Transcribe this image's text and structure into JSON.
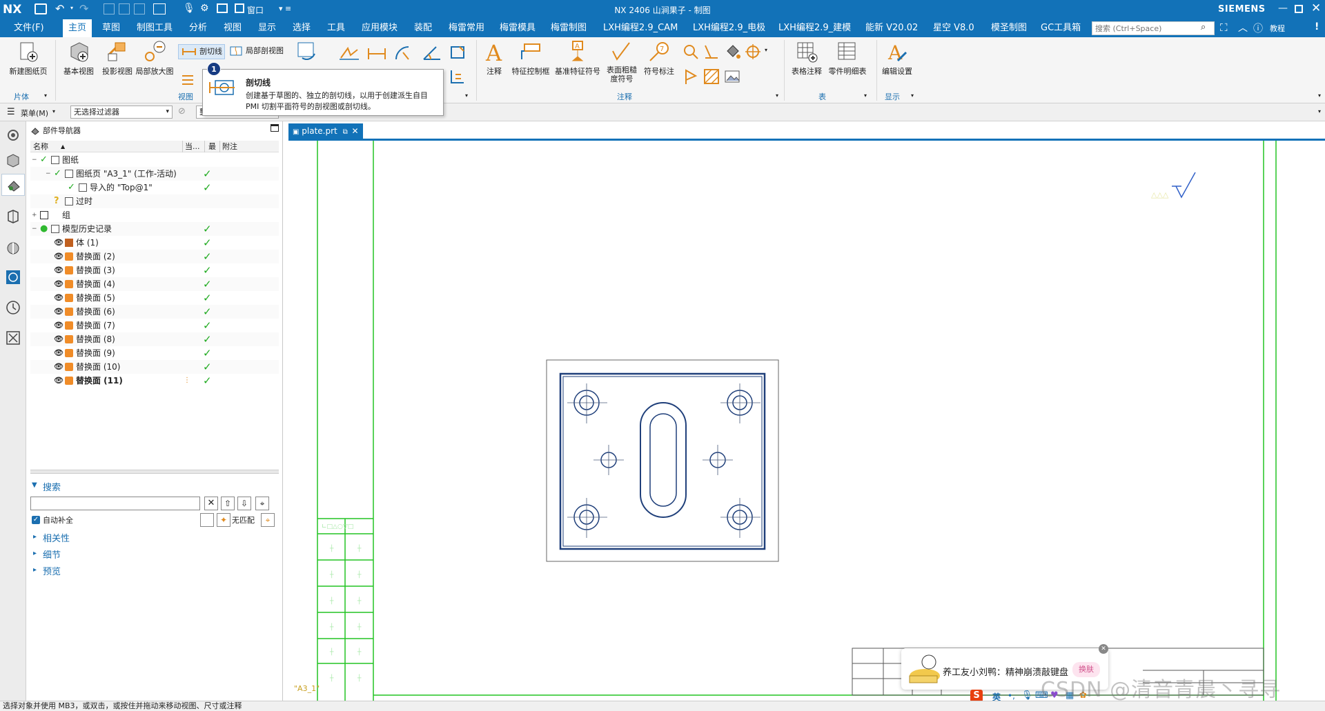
{
  "titlebar": {
    "logo": "NX",
    "title": "NX 2406 山涧果子 - 制图",
    "window_menu": "窗口",
    "brand": "SIEMENS"
  },
  "menubar": {
    "items": [
      "文件(F)",
      "主页",
      "草图",
      "制图工具",
      "分析",
      "视图",
      "显示",
      "选择",
      "工具",
      "应用模块",
      "装配",
      "梅雷常用",
      "梅雷模具",
      "梅雷制图",
      "LXH编程2.9_CAM",
      "LXH编程2.9_电极",
      "LXH编程2.9_建模",
      "能新 V20.02",
      "星空 V8.0",
      "模圣制图",
      "GC工具箱"
    ],
    "search_placeholder": "搜索 (Ctrl+Space)",
    "tutorial": "教程"
  },
  "ribbon": {
    "sheet_group": {
      "new_sheet": "新建图纸页",
      "label": "片体"
    },
    "view_group": {
      "base_view": "基本视图",
      "projected_view": "投影视图",
      "detail_view": "局部放大图",
      "section_line": "剖切线",
      "break_out_section": "局部剖视图",
      "label": "视图"
    },
    "annotation_group": {
      "note": "注释",
      "fcf": "特征控制框",
      "datum_feature": "基准特征符号",
      "surface_finish": "表面粗糙度符号",
      "balloon": "符号标注",
      "label": "注释"
    },
    "table_group": {
      "tabular_note": "表格注释",
      "parts_list": "零件明细表",
      "label": "表"
    },
    "display_group": {
      "edit_settings": "编辑设置",
      "label": "显示"
    }
  },
  "tooltip": {
    "badge": "1",
    "title": "剖切线",
    "description": "创建基于草图的、独立的剖切线，以用于创建派生自目PMI 切割平面符号的剖视图或剖切线。"
  },
  "filterbar": {
    "menu": "菜单(M)",
    "filter_value": "无选择过滤器",
    "partial": "整"
  },
  "navigator": {
    "title": "部件导航器",
    "columns": [
      "名称",
      "当...",
      "最",
      "附注"
    ],
    "tree": [
      {
        "label": "图纸",
        "depth": 0,
        "check": false
      },
      {
        "label": "图纸页 \"A3_1\" (工作-活动)",
        "depth": 1,
        "check": true
      },
      {
        "label": "导入的 \"Top@1\"",
        "depth": 2,
        "check": true
      },
      {
        "label": "过时",
        "depth": 1,
        "check": false
      },
      {
        "label": "组",
        "depth": 0,
        "check": false
      },
      {
        "label": "模型历史记录",
        "depth": 0,
        "check": true
      },
      {
        "label": "体 (1)",
        "depth": 1,
        "check": true
      },
      {
        "label": "替换面 (2)",
        "depth": 1,
        "check": true
      },
      {
        "label": "替换面 (3)",
        "depth": 1,
        "check": true
      },
      {
        "label": "替换面 (4)",
        "depth": 1,
        "check": true
      },
      {
        "label": "替换面 (5)",
        "depth": 1,
        "check": true
      },
      {
        "label": "替换面 (6)",
        "depth": 1,
        "check": true
      },
      {
        "label": "替换面 (7)",
        "depth": 1,
        "check": true
      },
      {
        "label": "替换面 (8)",
        "depth": 1,
        "check": true
      },
      {
        "label": "替换面 (9)",
        "depth": 1,
        "check": true
      },
      {
        "label": "替换面 (10)",
        "depth": 1,
        "check": true
      },
      {
        "label": "替换面 (11)",
        "depth": 1,
        "check": true
      }
    ],
    "search_title": "搜索",
    "auto_complete": "自动补全",
    "no_match": "无匹配",
    "sections": [
      "相关性",
      "细节",
      "预览"
    ]
  },
  "document": {
    "tab": "plate.prt",
    "sheet_label": "\"A3_1\""
  },
  "overlay": {
    "ime_text": "养工友小刘鸭：精神崩溃敲键盘",
    "ime_btn": "换肤",
    "ime_lang": "英",
    "watermark": "CSDN @清音青晨丶寻寻"
  },
  "statusbar": {
    "text": "选择对象并使用 MB3，或双击，或按住并拖动来移动视图、尺寸或注释"
  }
}
